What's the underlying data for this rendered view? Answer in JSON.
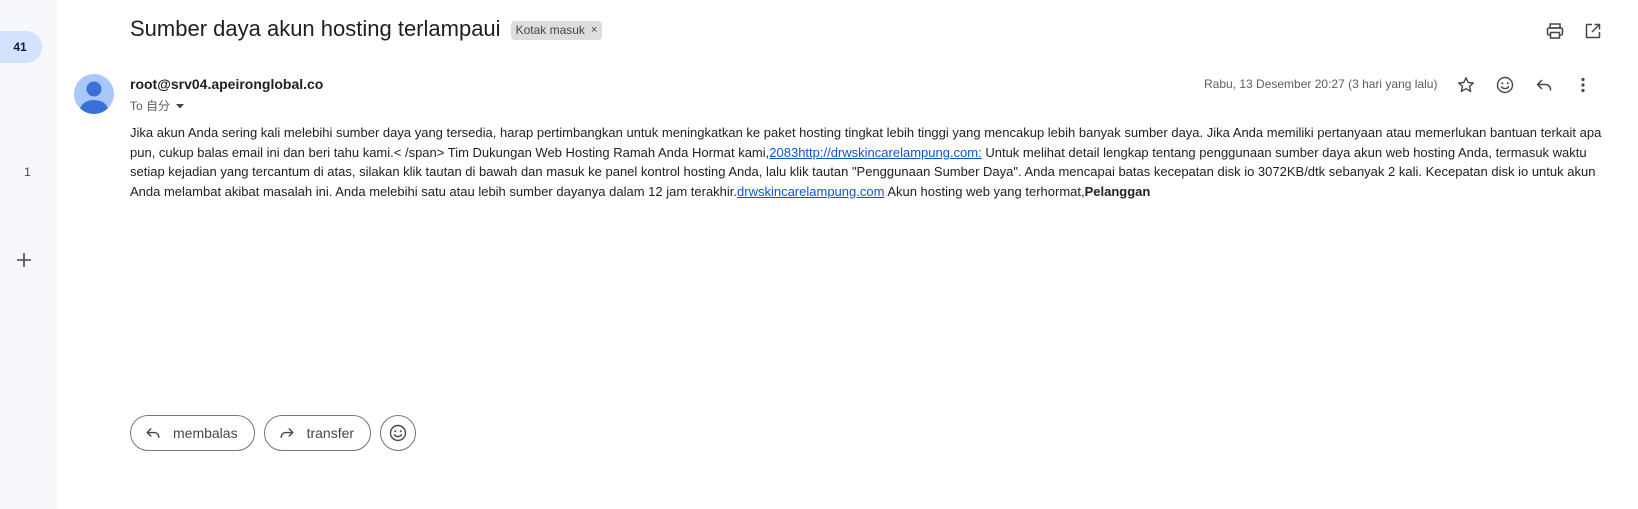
{
  "rail": {
    "inbox_count": "41",
    "secondary_count": "1"
  },
  "email": {
    "subject": "Sumber daya akun hosting terlampaui",
    "label": "Kotak masuk",
    "sender": "root@srv04.apeironglobal.co",
    "to": "To 自分",
    "date": "Rabu, 13 Desember 20:27 (3 hari yang lalu)",
    "body": {
      "part1": "Jika akun Anda sering kali melebihi sumber daya yang tersedia, harap pertimbangkan untuk meningkatkan ke paket hosting tingkat lebih tinggi yang mencakup lebih banyak sumber daya. Jika Anda memiliki pertanyaan atau memerlukan bantuan terkait apa pun, cukup balas email ini dan beri tahu kami.< /span> Tim Dukungan Web Hosting Ramah Anda Hormat kami,",
      "link1": "2083http://drwskincarelampung.com:",
      "part2": " Untuk melihat detail lengkap tentang penggunaan sumber daya akun web hosting Anda, termasuk waktu setiap kejadian yang tercantum di atas, silakan klik tautan di bawah dan masuk ke panel kontrol hosting Anda, lalu klik tautan \"Penggunaan Sumber Daya\". Anda mencapai batas kecepatan disk io 3072KB/dtk sebanyak 2 kali. Kecepatan disk io untuk akun Anda melambat akibat masalah ini. Anda melebihi satu atau lebih sumber dayanya dalam 12 jam terakhir.",
      "link2": "drwskincarelampung.com",
      "part3": " Akun hosting web yang terhormat,",
      "bold": "Pelanggan"
    }
  },
  "actions": {
    "reply_label": "membalas",
    "forward_label": "transfer"
  },
  "icons": {
    "print": "print-icon",
    "open_new": "open-in-new-icon",
    "star": "star-icon",
    "emoji": "emoji-icon",
    "reply": "reply-icon",
    "more": "more-vert-icon",
    "add": "plus-icon",
    "dropdown": "caret-down-icon",
    "avatar": "person-icon"
  }
}
